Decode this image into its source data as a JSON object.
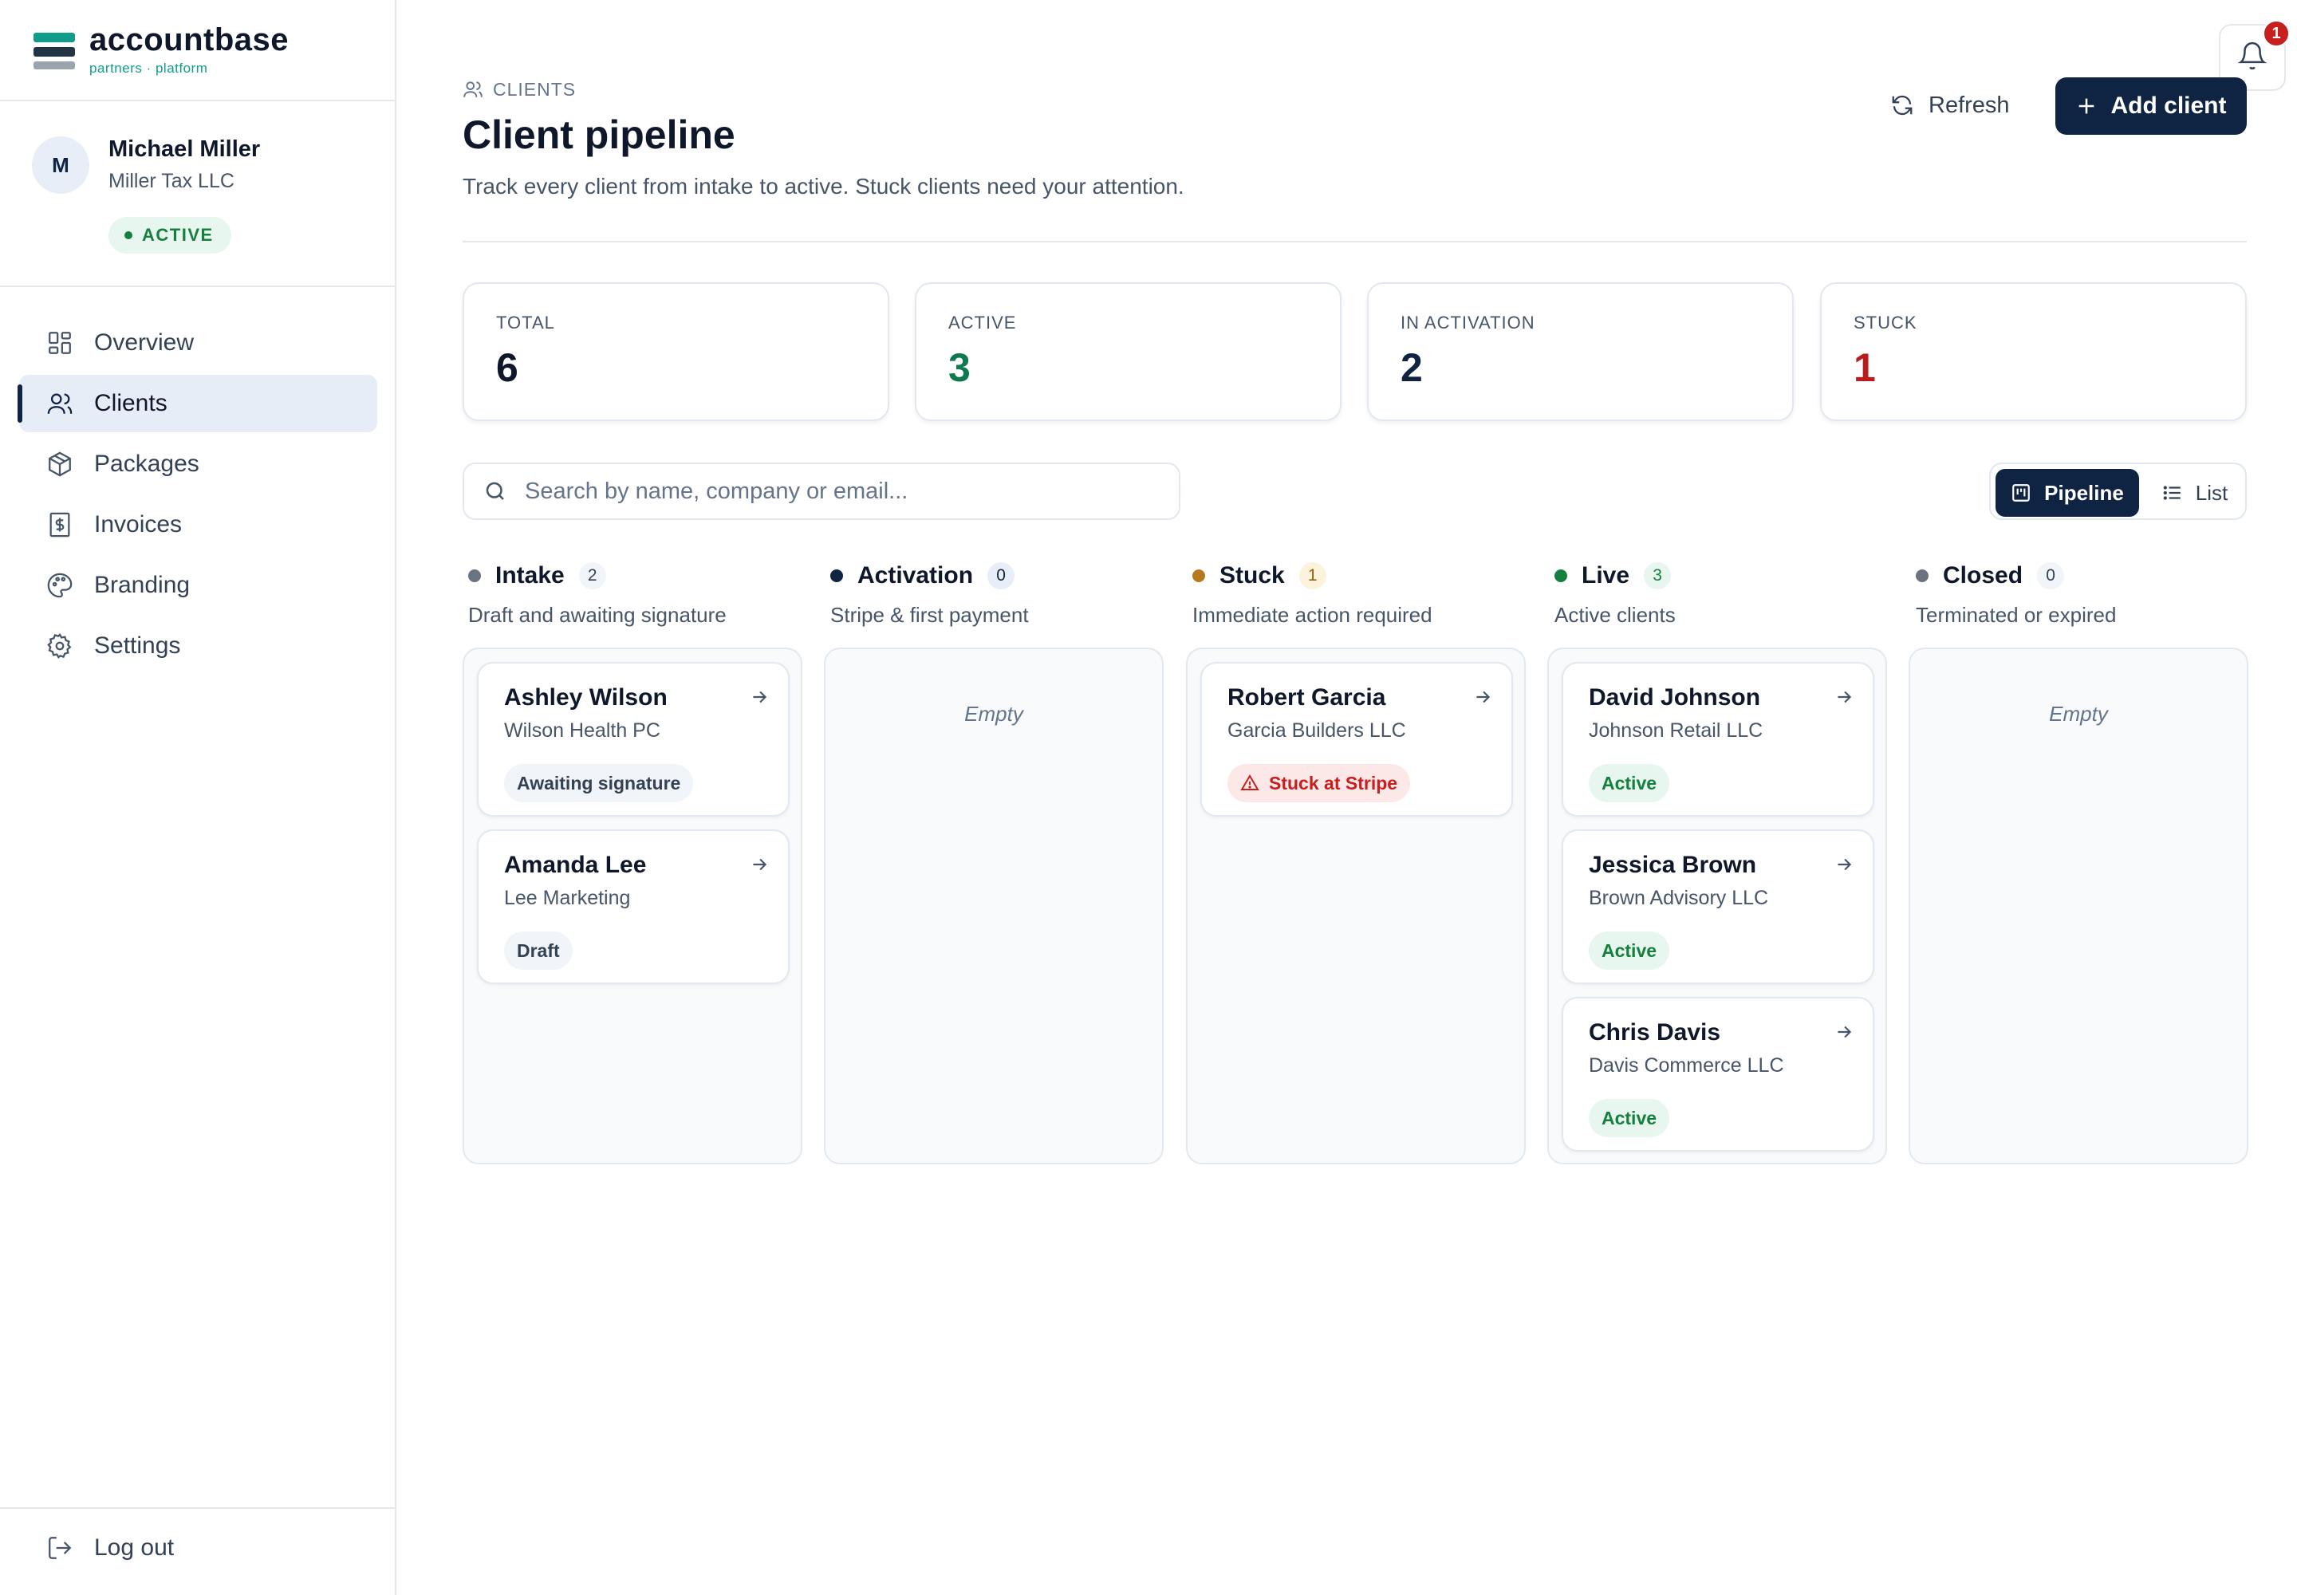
{
  "brand": {
    "name": "accountbase",
    "tagline": "partners · platform",
    "colors": {
      "accent": "#0f9d8a",
      "navy": "#0f2342"
    }
  },
  "user": {
    "initial": "M",
    "name": "Michael Miller",
    "company": "Miller Tax LLC",
    "status": "ACTIVE"
  },
  "nav": {
    "items": [
      {
        "label": "Overview",
        "icon": "grid-icon"
      },
      {
        "label": "Clients",
        "icon": "users-icon",
        "active": true
      },
      {
        "label": "Packages",
        "icon": "package-icon"
      },
      {
        "label": "Invoices",
        "icon": "dollar-receipt-icon"
      },
      {
        "label": "Branding",
        "icon": "palette-icon"
      },
      {
        "label": "Settings",
        "icon": "gear-icon"
      }
    ],
    "logout": "Log out"
  },
  "notifications": {
    "count": "1"
  },
  "header": {
    "breadcrumb": "CLIENTS",
    "title": "Client pipeline",
    "subtitle": "Track every client from intake to active. Stuck clients need your attention.",
    "refresh": "Refresh",
    "add_client": "Add client"
  },
  "stats": [
    {
      "label": "TOTAL",
      "value": "6",
      "color": "#0f172a"
    },
    {
      "label": "ACTIVE",
      "value": "3",
      "color": "#0f7a4f"
    },
    {
      "label": "IN ACTIVATION",
      "value": "2",
      "color": "#0f2342"
    },
    {
      "label": "STUCK",
      "value": "1",
      "color": "#b91c1c"
    }
  ],
  "search": {
    "placeholder": "Search by name, company or email..."
  },
  "view": {
    "pipeline": "Pipeline",
    "list": "List",
    "selected": "Pipeline"
  },
  "columns": [
    {
      "title": "Intake",
      "count": "2",
      "desc": "Draft and awaiting signature",
      "dot": "#6b7280",
      "cards": [
        {
          "name": "Ashley Wilson",
          "company": "Wilson Health PC",
          "badge": "Awaiting signature"
        },
        {
          "name": "Amanda Lee",
          "company": "Lee Marketing",
          "badge": "Draft"
        }
      ]
    },
    {
      "title": "Activation",
      "count": "0",
      "desc": "Stripe & first payment",
      "dot": "#0f2342",
      "empty": "Empty"
    },
    {
      "title": "Stuck",
      "count": "1",
      "desc": "Immediate action required",
      "dot": "#b7791f",
      "cards": [
        {
          "name": "Robert Garcia",
          "company": "Garcia Builders LLC",
          "badge": "Stuck at Stripe"
        }
      ]
    },
    {
      "title": "Live",
      "count": "3",
      "desc": "Active clients",
      "dot": "#15803d",
      "cards": [
        {
          "name": "David Johnson",
          "company": "Johnson Retail LLC",
          "badge": "Active"
        },
        {
          "name": "Jessica Brown",
          "company": "Brown Advisory LLC",
          "badge": "Active"
        },
        {
          "name": "Chris Davis",
          "company": "Davis Commerce LLC",
          "badge": "Active"
        }
      ]
    },
    {
      "title": "Closed",
      "count": "0",
      "desc": "Terminated or expired",
      "dot": "#6b7280",
      "empty": "Empty"
    }
  ]
}
